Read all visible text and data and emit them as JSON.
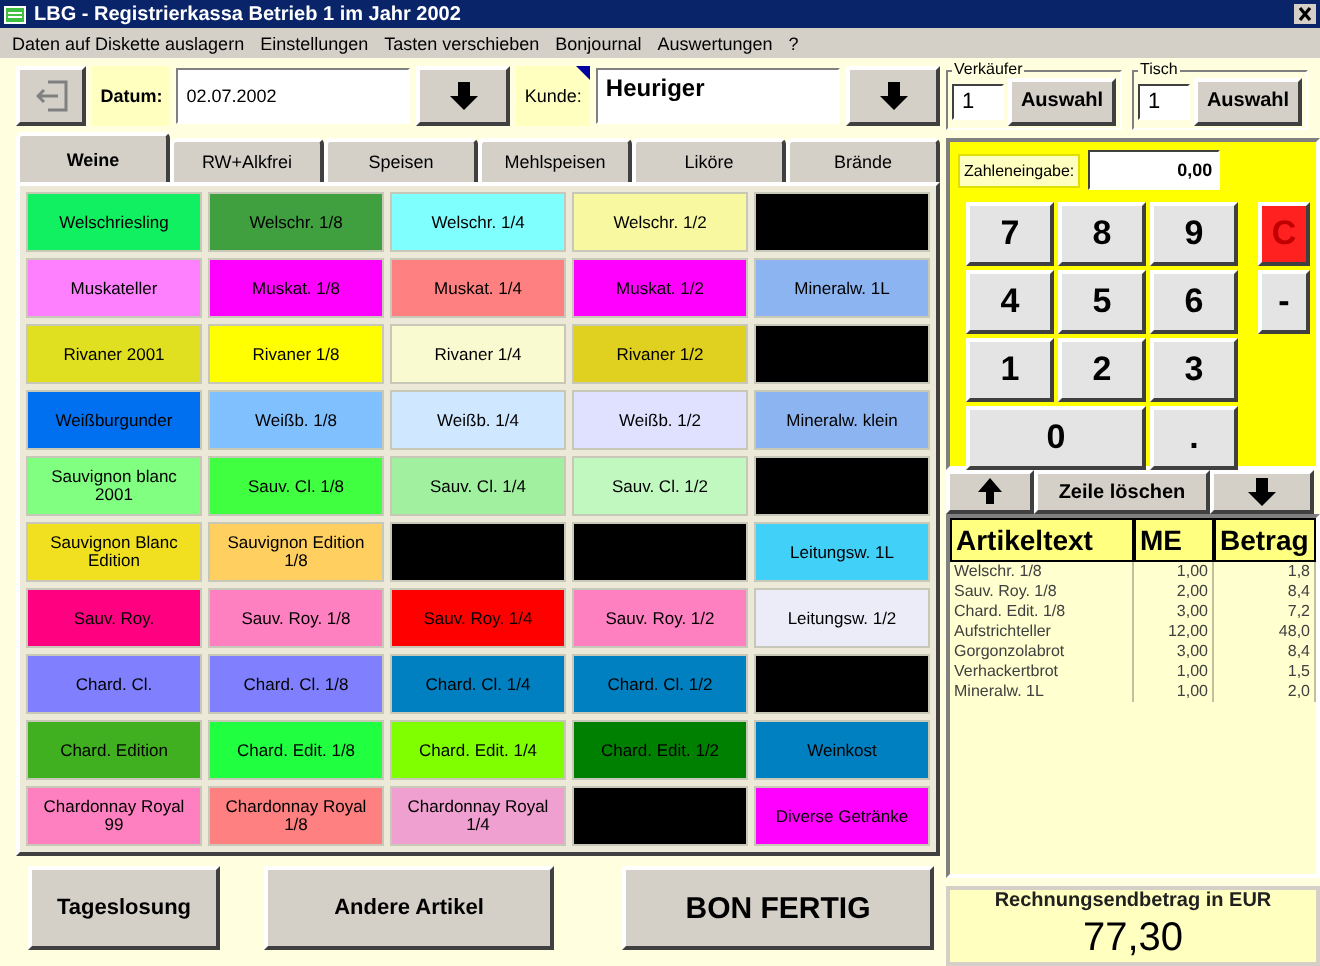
{
  "window": {
    "title": "LBG - Registrierkassa Betrieb 1 im Jahr 2002"
  },
  "menu": [
    "Daten auf Diskette auslagern",
    "Einstellungen",
    "Tasten verschieben",
    "Bonjournal",
    "Auswertungen",
    "?"
  ],
  "toolbar": {
    "date_label": "Datum:",
    "date": "02.07.2002",
    "customer_label": "Kunde:",
    "customer": "Heuriger"
  },
  "tabs": [
    {
      "label": "Weine",
      "selected": true
    },
    {
      "label": "RW+Alkfrei",
      "selected": false
    },
    {
      "label": "Speisen",
      "selected": false
    },
    {
      "label": "Mehlspeisen",
      "selected": false
    },
    {
      "label": "Liköre",
      "selected": false
    },
    {
      "label": "Brände",
      "selected": false
    }
  ],
  "articles": [
    {
      "label": "Welschriesling",
      "color": "#10f060"
    },
    {
      "label": "Welschr. 1/8",
      "color": "#40a040"
    },
    {
      "label": "Welschr. 1/4",
      "color": "#80ffff"
    },
    {
      "label": "Welschr. 1/2",
      "color": "#f8f8a0"
    },
    {
      "color": "#000000"
    },
    {
      "label": "Muskateller",
      "color": "#ff80ff"
    },
    {
      "label": "Muskat. 1/8",
      "color": "#ff00ff"
    },
    {
      "label": "Muskat. 1/4",
      "color": "#ff8080"
    },
    {
      "label": "Muskat. 1/2",
      "color": "#ff00ff"
    },
    {
      "label": "Mineralw. 1L",
      "color": "#8cb4f0"
    },
    {
      "label": "Rivaner 2001",
      "color": "#e0e020"
    },
    {
      "label": "Rivaner 1/8",
      "color": "#ffff00"
    },
    {
      "label": "Rivaner 1/4",
      "color": "#fafad0"
    },
    {
      "label": "Rivaner 1/2",
      "color": "#e0d020"
    },
    {
      "color": "#000000"
    },
    {
      "label": "Weißburgunder",
      "color": "#0070f0"
    },
    {
      "label": "Weißb. 1/8",
      "color": "#80c0ff"
    },
    {
      "label": "Weißb. 1/4",
      "color": "#d0e8ff"
    },
    {
      "label": "Weißb. 1/2",
      "color": "#e0e0ff"
    },
    {
      "label": "Mineralw. klein",
      "color": "#8cb4f0"
    },
    {
      "label": "Sauvignon blanc 2001",
      "color": "#80ff80"
    },
    {
      "label": "Sauv. Cl. 1/8",
      "color": "#40ff40"
    },
    {
      "label": "Sauv. Cl. 1/4",
      "color": "#a0f0a0"
    },
    {
      "label": "Sauv. Cl. 1/2",
      "color": "#c0f8c0"
    },
    {
      "color": "#000000"
    },
    {
      "label": "Sauvignon Blanc Edition",
      "color": "#f0e020"
    },
    {
      "label": "Sauvignon Edition 1/8",
      "color": "#ffd060"
    },
    {
      "color": "#000000"
    },
    {
      "color": "#000000"
    },
    {
      "label": "Leitungsw. 1L",
      "color": "#40d0f8"
    },
    {
      "label": "Sauv. Roy.",
      "color": "#ff0080"
    },
    {
      "label": "Sauv. Roy. 1/8",
      "color": "#ff80c0"
    },
    {
      "label": "Sauv. Roy. 1/4",
      "color": "#ff0000"
    },
    {
      "label": "Sauv. Roy. 1/2",
      "color": "#ff80c0"
    },
    {
      "label": "Leitungsw. 1/2",
      "color": "#ececf8"
    },
    {
      "label": "Chard. Cl.",
      "color": "#8080ff"
    },
    {
      "label": "Chard. Cl. 1/8",
      "color": "#8080ff"
    },
    {
      "label": "Chard. Cl. 1/4",
      "color": "#0080c0"
    },
    {
      "label": "Chard. Cl. 1/2",
      "color": "#0080c0"
    },
    {
      "color": "#000000"
    },
    {
      "label": "Chard. Edition",
      "color": "#40b020"
    },
    {
      "label": "Chard. Edit. 1/8",
      "color": "#20ff40"
    },
    {
      "label": "Chard. Edit. 1/4",
      "color": "#80ff00"
    },
    {
      "label": "Chard. Edit. 1/2",
      "color": "#008000"
    },
    {
      "label": "Weinkost",
      "color": "#0080c0"
    },
    {
      "label": "Chardonnay Royal 99",
      "color": "#ff80c0"
    },
    {
      "label": "Chardonnay Royal 1/8",
      "color": "#ff8080"
    },
    {
      "label": "Chardonnay Royal 1/4",
      "color": "#f0a0d0"
    },
    {
      "color": "#000000"
    },
    {
      "label": "Diverse Getränke",
      "color": "#ff00ff"
    }
  ],
  "bottom_buttons": [
    "Tageslosung",
    "Andere Artikel",
    "BON FERTIG"
  ],
  "seller": {
    "legend": "Verkäufer",
    "value": "1",
    "button": "Auswahl"
  },
  "table_select": {
    "legend": "Tisch",
    "value": "1",
    "button": "Auswahl"
  },
  "number_entry": {
    "label": "Zahleneingabe:",
    "value": "0,00"
  },
  "keypad": [
    {
      "label": "7",
      "kind": "digit"
    },
    {
      "label": "8",
      "kind": "digit"
    },
    {
      "label": "9",
      "kind": "digit"
    },
    {
      "label": "C",
      "kind": "clear"
    },
    {
      "label": "4",
      "kind": "digit"
    },
    {
      "label": "5",
      "kind": "digit"
    },
    {
      "label": "6",
      "kind": "digit"
    },
    {
      "label": "-",
      "kind": "side"
    },
    {
      "label": "1",
      "kind": "digit"
    },
    {
      "label": "2",
      "kind": "digit"
    },
    {
      "label": "3",
      "kind": "digit"
    },
    {
      "label": "0",
      "kind": "wide"
    },
    {
      "label": ".",
      "kind": "digit"
    }
  ],
  "delete_row": "Zeile löschen",
  "receipt": {
    "columns": [
      "Artikeltext",
      "ME",
      "Betrag"
    ],
    "rows": [
      [
        "Welschr. 1/8",
        "1,00",
        "1,8"
      ],
      [
        "Sauv. Roy. 1/8",
        "2,00",
        "8,4"
      ],
      [
        "Chard. Edit. 1/8",
        "3,00",
        "7,2"
      ],
      [
        "Aufstrichteller",
        "12,00",
        "48,0"
      ],
      [
        "Gorgonzolabrot",
        "3,00",
        "8,4"
      ],
      [
        "Verhackertbrot",
        "1,00",
        "1,5"
      ],
      [
        "Mineralw. 1L",
        "1,00",
        "2,0"
      ]
    ]
  },
  "total": {
    "label": "Rechnungsendbetrag in EUR",
    "value": "77,30"
  }
}
